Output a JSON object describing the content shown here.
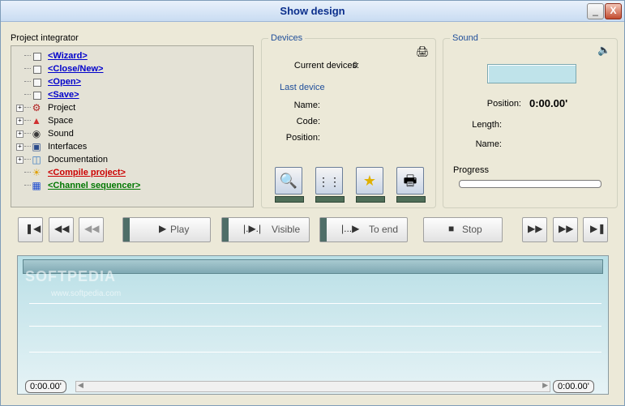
{
  "window": {
    "title": "Show design",
    "minimize_label": "_",
    "close_label": "X"
  },
  "project": {
    "label": "Project integrator",
    "items": [
      {
        "label": "<Wizard>",
        "style": "blue",
        "expandable": false,
        "icon": "checkbox"
      },
      {
        "label": "<Close/New>",
        "style": "blue",
        "expandable": false,
        "icon": "checkbox"
      },
      {
        "label": "<Open>",
        "style": "blue",
        "expandable": false,
        "icon": "checkbox"
      },
      {
        "label": "<Save>",
        "style": "blue",
        "expandable": false,
        "icon": "checkbox"
      },
      {
        "label": "Project",
        "style": "plain",
        "expandable": true,
        "icon": "project-icon"
      },
      {
        "label": "Space",
        "style": "plain",
        "expandable": true,
        "icon": "space-icon"
      },
      {
        "label": "Sound",
        "style": "plain",
        "expandable": true,
        "icon": "sound-icon"
      },
      {
        "label": "Interfaces",
        "style": "plain",
        "expandable": true,
        "icon": "interfaces-icon"
      },
      {
        "label": "Documentation",
        "style": "plain",
        "expandable": true,
        "icon": "documentation-icon"
      },
      {
        "label": "<Compile project>",
        "style": "red",
        "expandable": false,
        "icon": "compile-icon"
      },
      {
        "label": "<Channel sequencer>",
        "style": "green",
        "expandable": false,
        "icon": "sequencer-icon"
      }
    ]
  },
  "devices": {
    "title": "Devices",
    "current_label": "Current devices:",
    "current_value": "0",
    "last_device": "Last device",
    "name_label": "Name:",
    "code_label": "Code:",
    "position_label": "Position:"
  },
  "sound": {
    "title": "Sound",
    "position_label": "Position:",
    "position_value": "0:00.00'",
    "length_label": "Length:",
    "name_label": "Name:",
    "progress_label": "Progress",
    "progress": 0
  },
  "controls": {
    "play": "Play",
    "visible": "Visible",
    "to_end": "To end",
    "stop": "Stop"
  },
  "sequencer": {
    "start_time": "0:00.00'",
    "end_time": "0:00.00'",
    "watermark": "SOFTPEDIA",
    "watermark_url": "www.softpedia.com"
  }
}
